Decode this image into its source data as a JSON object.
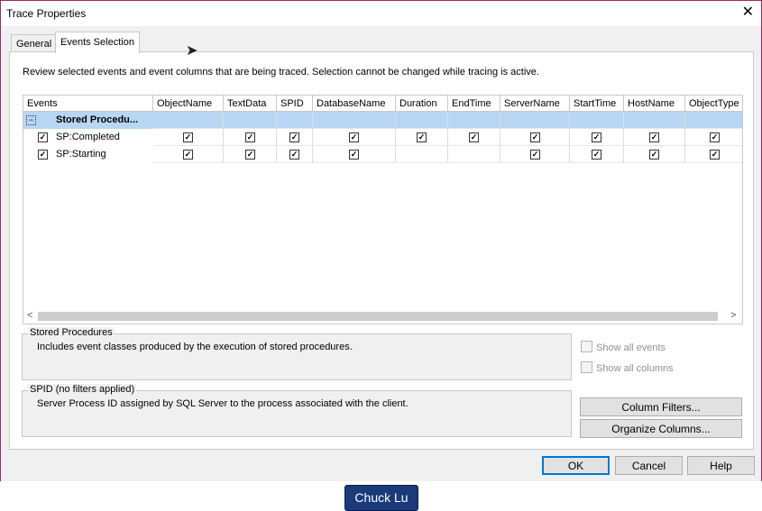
{
  "window": {
    "title": "Trace Properties",
    "close_glyph": "✕"
  },
  "tabs": [
    {
      "label": "General"
    },
    {
      "label": "Events Selection"
    }
  ],
  "description": "Review selected events and event columns that are being traced. Selection cannot be changed while tracing is active.",
  "grid": {
    "columns": [
      "Events",
      "ObjectName",
      "TextData",
      "SPID",
      "DatabaseName",
      "Duration",
      "EndTime",
      "ServerName",
      "StartTime",
      "HostName",
      "ObjectType"
    ],
    "group": {
      "label": "Stored Procedu...",
      "expander": "−"
    },
    "rows": [
      {
        "label": "SP:Completed",
        "checks": [
          true,
          true,
          true,
          true,
          true,
          true,
          true,
          true,
          true,
          true
        ]
      },
      {
        "label": "SP:Starting",
        "checks": [
          true,
          true,
          true,
          true,
          false,
          false,
          true,
          true,
          true,
          true
        ]
      }
    ]
  },
  "scroll": {
    "left_arrow": "<",
    "right_arrow": ">"
  },
  "event_info": {
    "title": "Stored Procedures",
    "text": "Includes event classes produced by the execution of stored procedures."
  },
  "column_info": {
    "title": "SPID (no filters applied)",
    "text": "Server Process ID assigned by SQL Server to the process associated with the client."
  },
  "options": {
    "show_all_events": "Show all events",
    "show_all_columns": "Show all columns"
  },
  "buttons": {
    "column_filters": "Column Filters...",
    "organize_columns": "Organize Columns...",
    "ok": "OK",
    "cancel": "Cancel",
    "help": "Help"
  },
  "author_badge": "Chuck Lu"
}
